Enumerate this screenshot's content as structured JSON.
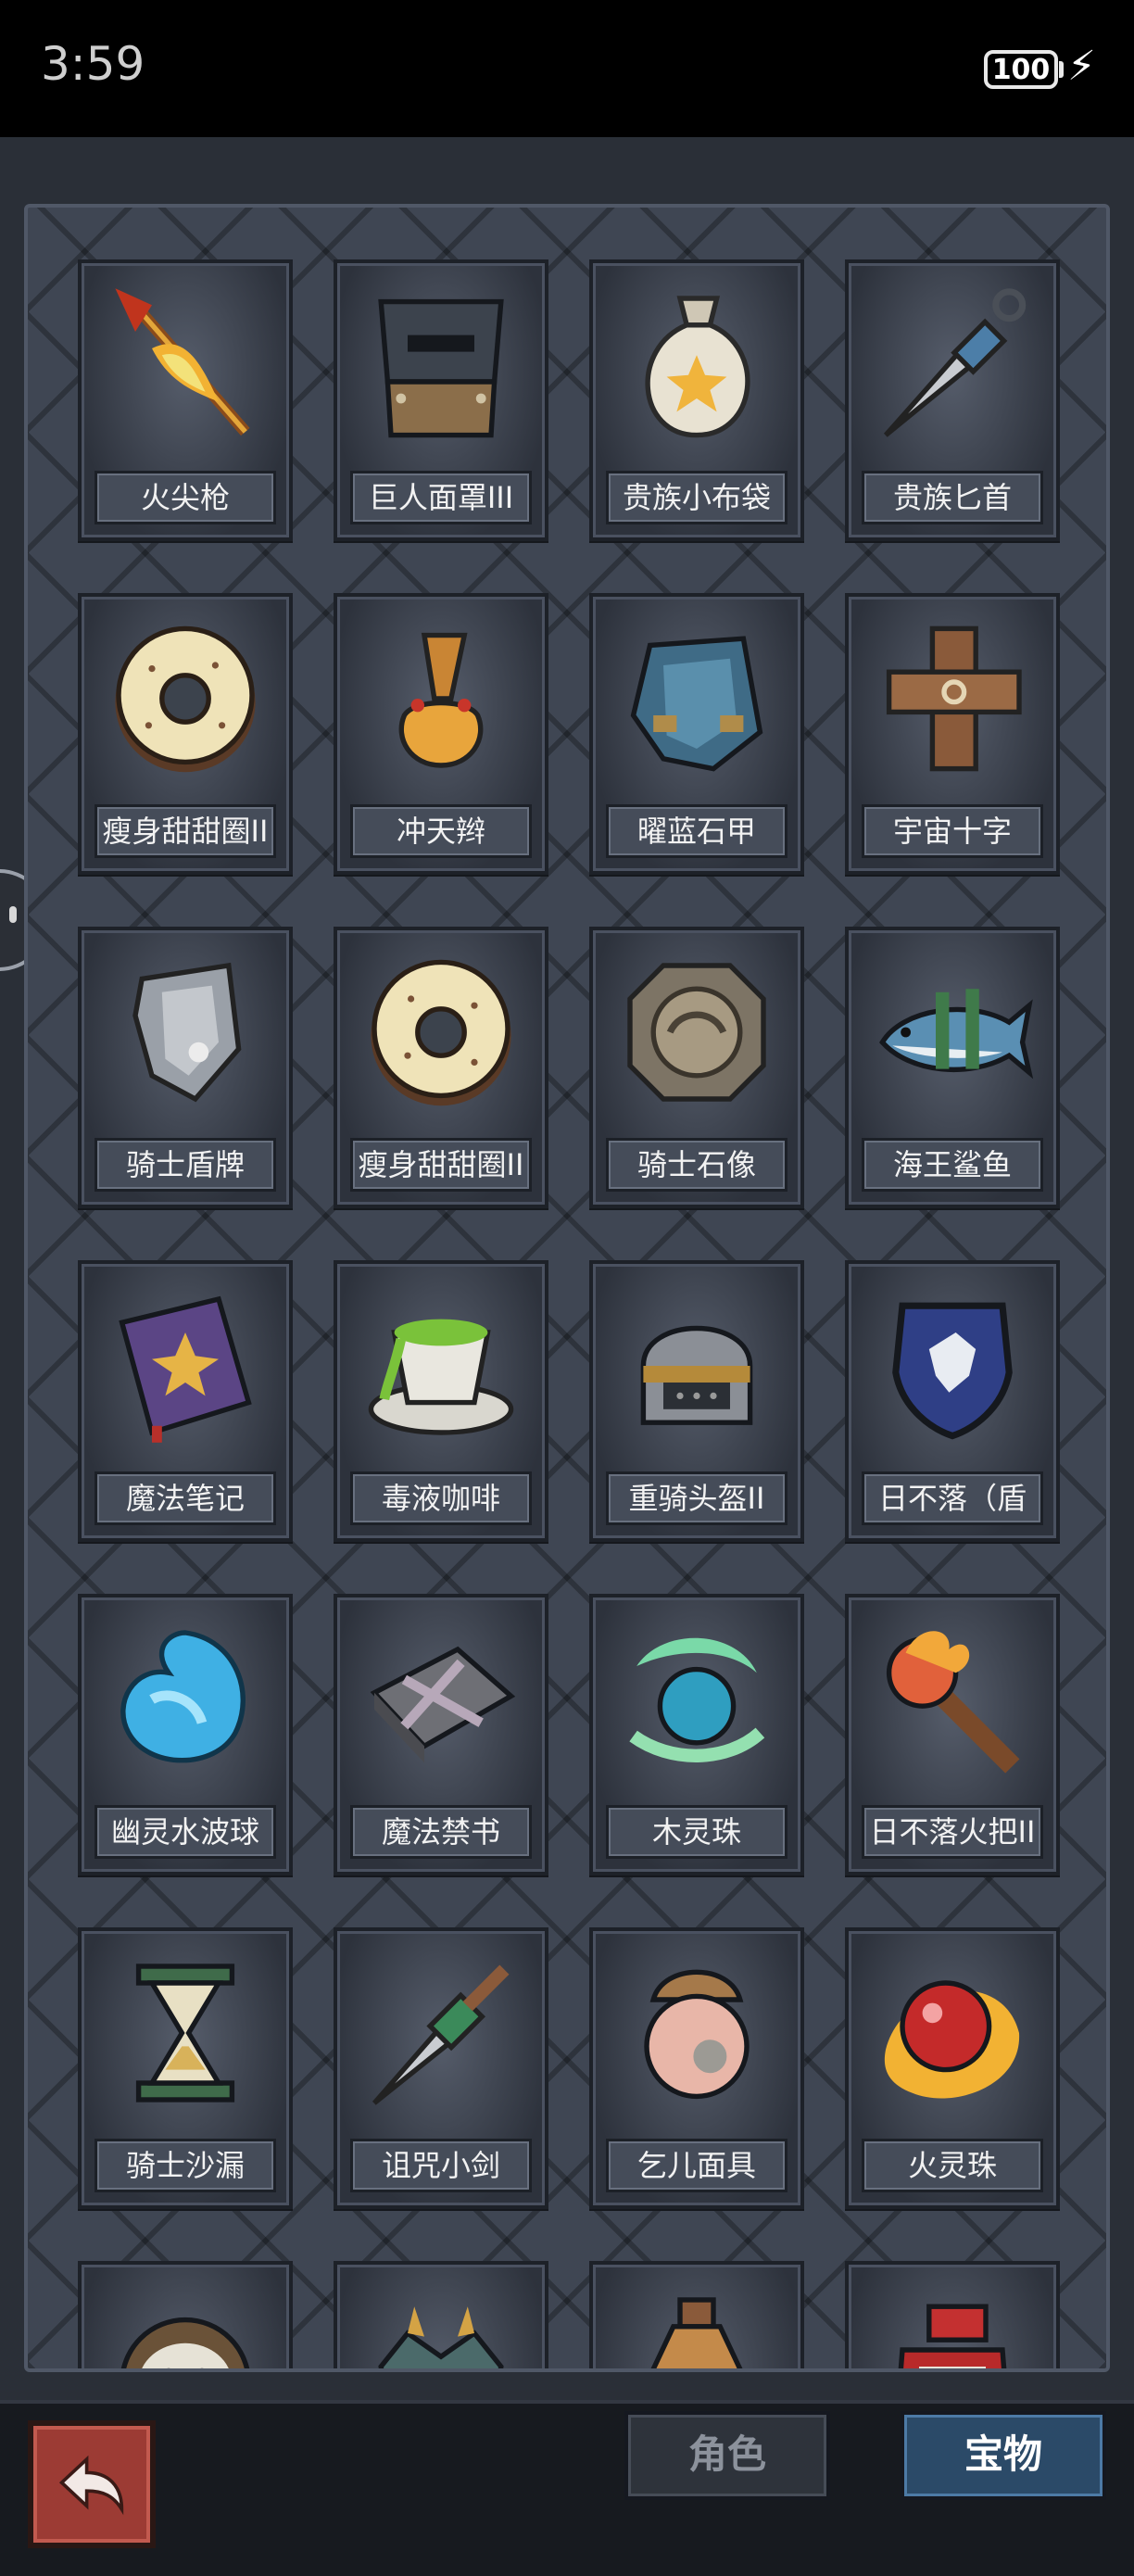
{
  "status": {
    "time": "3:59",
    "battery": "100"
  },
  "items": [
    {
      "label": "火尖枪",
      "icon": "fire-spear-icon"
    },
    {
      "label": "巨人面罩III",
      "icon": "giant-mask-icon"
    },
    {
      "label": "贵族小布袋",
      "icon": "noble-pouch-icon"
    },
    {
      "label": "贵族匕首",
      "icon": "noble-dagger-icon"
    },
    {
      "label": "瘦身甜甜圈II",
      "icon": "donut-icon"
    },
    {
      "label": "冲天辫",
      "icon": "pigtail-icon"
    },
    {
      "label": "曜蓝石甲",
      "icon": "blue-armor-icon"
    },
    {
      "label": "宇宙十字",
      "icon": "cosmic-cross-icon"
    },
    {
      "label": "骑士盾牌",
      "icon": "knight-shield-icon"
    },
    {
      "label": "瘦身甜甜圈II",
      "icon": "donut-icon"
    },
    {
      "label": "骑士石像",
      "icon": "stone-medallion-icon"
    },
    {
      "label": "海王鲨鱼",
      "icon": "shark-icon"
    },
    {
      "label": "魔法笔记",
      "icon": "magic-book-icon"
    },
    {
      "label": "毒液咖啡",
      "icon": "poison-coffee-icon"
    },
    {
      "label": "重骑头盔II",
      "icon": "helmet-icon"
    },
    {
      "label": "日不落（盾",
      "icon": "blue-shield-icon"
    },
    {
      "label": "幽灵水波球",
      "icon": "water-orb-icon"
    },
    {
      "label": "魔法禁书",
      "icon": "forbidden-book-icon"
    },
    {
      "label": "木灵珠",
      "icon": "wood-orb-icon"
    },
    {
      "label": "日不落火把II",
      "icon": "torch-icon"
    },
    {
      "label": "骑士沙漏",
      "icon": "hourglass-icon"
    },
    {
      "label": "诅咒小剑",
      "icon": "cursed-dagger-icon"
    },
    {
      "label": "乞儿面具",
      "icon": "beggar-mask-icon"
    },
    {
      "label": "火灵珠",
      "icon": "fire-orb-icon"
    },
    {
      "label": "",
      "icon": "skull-helmet-icon"
    },
    {
      "label": "",
      "icon": "spiked-armor-icon"
    },
    {
      "label": "",
      "icon": "potion-bottle-icon"
    },
    {
      "label": "",
      "icon": "red-scroll-icon"
    }
  ],
  "tabs": {
    "character": "角色",
    "treasure": "宝物"
  },
  "colors": {
    "active_tab": "#2b4a68",
    "back_button": "#9c3b34"
  }
}
